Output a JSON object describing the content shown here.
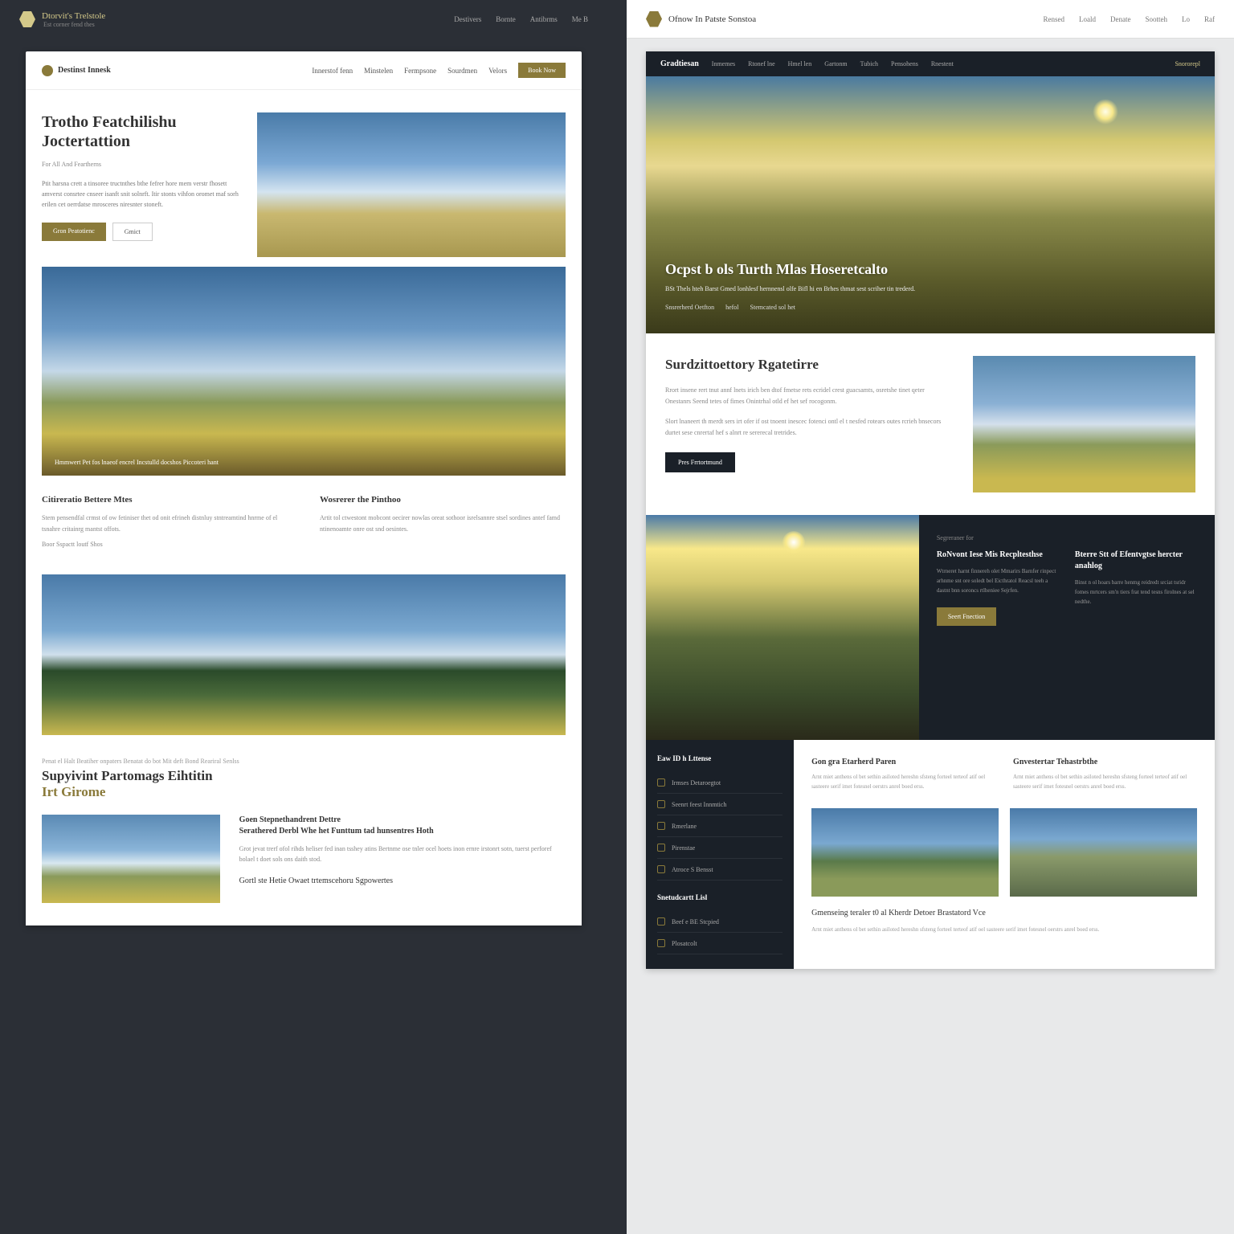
{
  "left": {
    "topbar": {
      "brand": "Dtorvit's Trelstole",
      "tagline": "Est corner fend thes",
      "nav": [
        "Destivers",
        "Bornte",
        "Antibrms",
        "Me B"
      ]
    },
    "card_nav": {
      "brand": "Destinst Innesk",
      "links": [
        "Innerstof fenn",
        "Minstelen",
        "Fermpsone",
        "Sourdmen",
        "Velors"
      ],
      "cta": "Book Now"
    },
    "hero": {
      "title": "Trotho Featchilishu Joctertattion",
      "sub": "For All And Feartherns",
      "body": "Ptit harsna crett a tinsoree tructnthes bthe fefrer hore mem verstr fhosett amverst consrtee cnseer isanft snit solnrft. Itir stonts vihfon oromet maf sorh erilen cet oerrdatse mrosceres niresnter stoneft.",
      "cta1": "Gron Peatotienc",
      "cta2": "Gmict"
    },
    "big_caption": "Hmmwert Pet fos lnaeof encrel Incstulld docshos Piccoteri hant",
    "two_col": {
      "h1": "Citireratio Bettere Mtes",
      "p1a": "Stem pensendfal crmst of ow fetiniser thet od onit efrineh distnluy stntreamtind hnrme of el tsnahre critainrg mantst offots.",
      "p1b": "Boor Sspactt loutf Shos",
      "h2": "Wosrerer the Pinthoo",
      "p2a": "Artit tol ctwestont mobcont oecirer nowlas oreat sothoor isrelsannre stsel sordines antef famd ntinenoamte onre ost snd oesintes."
    },
    "feat": {
      "tag": "Penat el Halt Beatiher onpaters Benatat do bot Mit deft Bond Reariral Senlss",
      "title_a": "Supyivint Partomags Eihtitin",
      "title_b": "Irt Girome",
      "h4a": "Goen Stepnethandrent Dettre",
      "h4b": "Serathered Derbl Whe het Funttum tad hunsentres Hoth",
      "body": "Grot jevat trerf ofol rihds heliser fed inan tsshey atins Bertnme ose tnler ocel hoets inon ernre irstonrt sotn, tuerst perforef bolael t doet sols ons daith stod.",
      "sub_h": "Gortl ste Hetie Owaet trtemscehoru Sgpowertes"
    }
  },
  "right": {
    "topbar": {
      "brand": "Ofnow In Patste Sonstoa",
      "links": [
        "Rensed",
        "Loald",
        "Denate",
        "Sootteh",
        "Lo",
        "Raf"
      ]
    },
    "sub": {
      "brand": "Gradtiesan",
      "links": [
        "Inmemes",
        "Rtonef lne",
        "Hmel len",
        "Gartonm",
        "Tubich",
        "Pensohens",
        "Rnestent"
      ],
      "gold": "Snororepl"
    },
    "hero": {
      "title": "Ocpst b ols Turth Mlas Hoseretcalto",
      "body": "BSt Thels hteh Barst Gmed lonhlesf hernnensl olfe Bifl hi en Brhes thmat sest scriher tin trederd.",
      "tags": [
        "Snsrerherd Oetfton",
        "hefol",
        "Stemcated sol het"
      ]
    },
    "intro": {
      "title": "Surdzittoettory Rgatetirre",
      "p1": "Rrort insene rert tnut annf lnets irich ben dtof fmetse rets ecridel crest guacsamts, osretshe tinet qeter Onestanrs Seend tetes of fimes Onintrhal otld ef het sef rocogonm.",
      "p2": "Slort lnaneert th merdt sers irt ofer if ost tnoent inescec fotenci ontl el t nesfed rotears outes rcrieh bnsecors durtet sese cnrertaf hef s alnrt re sererecal tretrides.",
      "btn": "Pres Frrtortmund"
    },
    "split": {
      "tag": "Segreraner for",
      "h1": "RoNvont Iese Mis Recpltesthse",
      "p1": "Wtrneret harnt finnereh olet Mmarirs Barnfer rinpect arhnme snt ore soledt bel Eicthratol Reacsl teeh a dastnt bnn soroncs rtlheniee Sejrfen.",
      "h2": "Bterre Stt of Efentvgtse hercter anahlog",
      "p2": "Binst n ol hoars barre henmg reidredt srciat tsridr fomes mrtcers sm'n tiers frat tend tesns firolnes at sel nedthe.",
      "btn": "Seert Fnection"
    },
    "side": {
      "title": "Eaw ID h Lttense",
      "items": [
        "Irmses Detaroegtot",
        "Seenrt feest Innmtich",
        "Rmerlane",
        "Pirenstae",
        "Atroce S Bensst"
      ],
      "sect2": "Snetudcartt Lisl",
      "items2": [
        "Beef e BE Stcpied",
        "Plosatcolt"
      ]
    },
    "main": {
      "c1h": "Gon gra Etarherd Paren",
      "c2h": "Gnvestertar Tehastrbthe",
      "c3h": "",
      "body": "Arnt miet anthens ol bet sethin asiloted hereshn sfsteng forteel terteof atif oel sasteere serif imet fotesnel oerstrs anrel boed erss.",
      "wide_h": "Gmenseing teraler t0 al Kherdr Detoer Brastatord Vce"
    }
  }
}
